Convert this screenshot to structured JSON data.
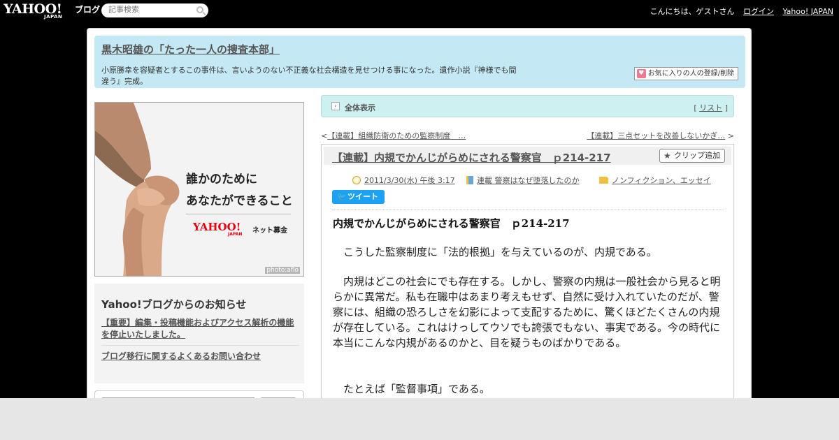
{
  "topbar": {
    "logo": "YAHOO!",
    "logo_sub": "JAPAN",
    "logo_blog": "ブログ",
    "search_placeholder": "記事検索",
    "greeting": "こんにちは、ゲストさん",
    "login": "ログイン",
    "yahoo_japan": "Yahoo! JAPAN"
  },
  "header": {
    "blog_title": "黒木昭雄の「たった一人の捜査本部」",
    "description": "小原勝幸を容疑者とするこの事件は、言いようのない不正義な社会構造を見せつける事になった。遺作小説『神様でも間違う』完成。",
    "fav_button": "お気に入りの人の登録/削除"
  },
  "ad": {
    "line1": "誰かのために",
    "line2": "あなたができること",
    "logo": "YAHOO!",
    "logo_sub": "JAPAN",
    "net": "ネット募金",
    "credit": "photo:aflo"
  },
  "notice": {
    "title": "Yahoo!ブログからのお知らせ",
    "link1": "【重要】編集・投稿機能およびアクセス解析の機能を停止いたしました。",
    "link2": "ブログ移行に関するよくあるお問い合わせ"
  },
  "viewbar": {
    "label": "全体表示",
    "list_open": "[",
    "list_link": "リスト",
    "list_close": "]"
  },
  "nav": {
    "prev_arrow": "<",
    "prev": "【連載】組織防衛のための監察制度　…",
    "next": "【連載】三点セットを改善しないかぎ…",
    "next_arrow": ">"
  },
  "article": {
    "title": "【連載】内規でかんじがらめにされる警察官　ｐ214-217",
    "clip_button": "クリップ追加",
    "date": "2011/3/30(水) 午後 3:17",
    "series": "連載 警察はなぜ堕落したのか",
    "category": "ノンフィクション、エッセイ",
    "tweet": "ツイート",
    "body_head": "内規でかんじがらめにされる警察官　ｐ214-217",
    "p1": "　こうした監察制度に「法的根拠」を与えているのが、内規である。",
    "p2": "　内規はどこの社会にでも存在する。しかし、警察の内規は一般社会から見ると明らかに異常だ。私も在職中はあまり考えもせず、自然に受け入れていたのだが、警察には、組織の恐ろしさを幻影によって支配するために、驚くほどたくさんの内規が存在している。これはけっしてウソでも誇張でもない、事実である。今の時代に本当にこんな内規があるのかと、目を疑うものばかりである。",
    "p3": "　たとえば「監督事項」である。"
  }
}
